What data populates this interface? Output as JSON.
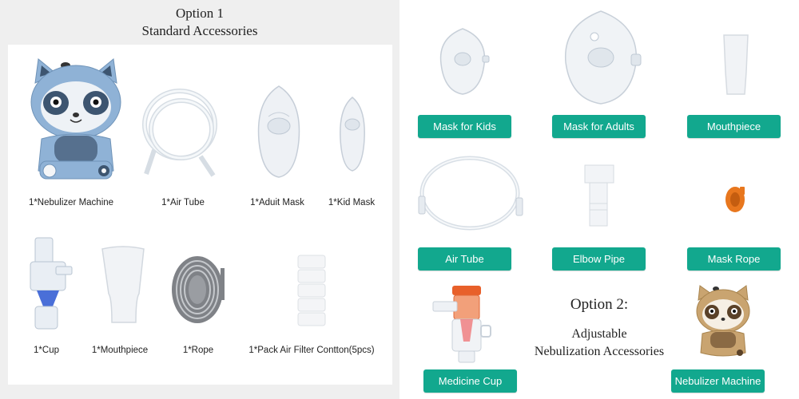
{
  "option1": {
    "title_line1": "Option 1",
    "title_line2": "Standard Accessories",
    "items": [
      "1*Nebulizer Machine",
      "1*Air Tube",
      "1*Aduit Mask",
      "1*Kid Mask",
      "1*Cup",
      "1*Mouthpiece",
      "1*Rope",
      "1*Pack Air Filter Contton(5pcs)"
    ]
  },
  "option2": {
    "title_line1": "Option 2:",
    "title_line2": "Adjustable",
    "title_line3": "Nebulization Accessories",
    "labels": [
      "Mask for Kids",
      "Mask for Adults",
      "Mouthpiece",
      "Air Tube",
      "Elbow Pipe",
      "Mask Rope",
      "Medicine Cup",
      "Nebulizer Machine"
    ]
  },
  "colors": {
    "label_bg": "#12a88e",
    "machine_blue": "#8fb2d6",
    "machine_tan": "#c9a470",
    "rope_orange": "#e8771e"
  }
}
